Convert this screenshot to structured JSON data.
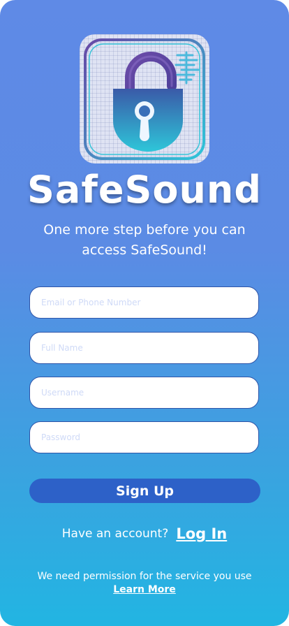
{
  "app": {
    "name": "SafeSound"
  },
  "header": {
    "subtitle": "One more step before you can access SafeSound!"
  },
  "form": {
    "email_placeholder": "Email or Phone Number",
    "fullname_placeholder": "Full Name",
    "username_placeholder": "Username",
    "password_placeholder": "Password",
    "signup_label": "Sign Up"
  },
  "footer": {
    "have_account": "Have an account?",
    "login_label": "Log In",
    "permission_text": "We need permission for the service you use",
    "learn_more": "Learn More"
  },
  "colors": {
    "accent": "#2d61c8",
    "field_border": "#2d54a8",
    "gradient_top": "#5f8ae6",
    "gradient_bottom": "#22b5e2"
  },
  "icons": {
    "logo": "padlock-soundwave-icon"
  }
}
